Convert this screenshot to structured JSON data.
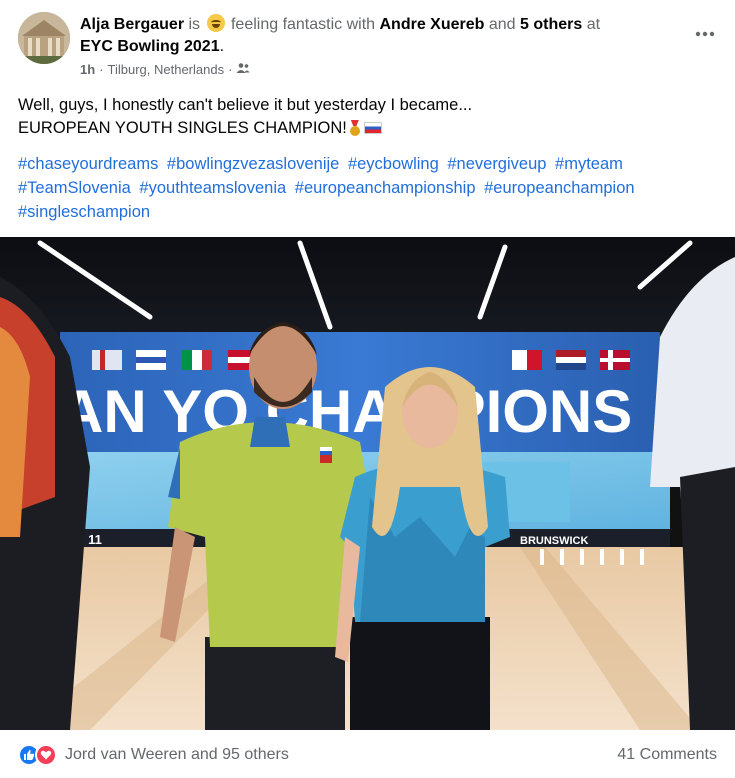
{
  "post": {
    "author": "Alja Bergauer",
    "is_word": "is",
    "feeling": "feeling fantastic with",
    "with_person": "Andre Xuereb",
    "and_word": "and",
    "others": "5 others",
    "at_word": "at",
    "place": "EYC Bowling 2021",
    "period": ".",
    "time": "1h",
    "location": "Tilburg, Netherlands",
    "separator": "·",
    "more_icon": "more-horizontal-icon",
    "audience_icon": "friends-audience-icon",
    "emoji_icon": "laughing-emoji-icon",
    "text_line1": "Well, guys, I honestly can't believe it but yesterday I became...",
    "text_line2": "EUROPEAN YOUTH SINGLES CHAMPION!",
    "hashtags": [
      "#chaseyourdreams",
      "#bowlingzvezaslovenije",
      "#eycbowling",
      "#nevergiveup",
      "#myteam",
      "#TeamSlovenia",
      "#youthteamslovenia",
      "#europeanchampionship",
      "#europeanchampion",
      "#singleschampion"
    ],
    "photo_banner_text": "AN YO    CHAMPIONS",
    "photo_brand": "BRUNSWICK",
    "photo_lane_numbers": "10  11"
  },
  "footer": {
    "reactions_text": "Jord van Weeren and 95 others",
    "comments_text": "41 Comments",
    "like_icon": "like-icon",
    "love_icon": "love-icon"
  },
  "colors": {
    "hashtag": "#216fdb",
    "muted": "#65676b",
    "like": "#1877f2",
    "love": "#f33e58"
  }
}
